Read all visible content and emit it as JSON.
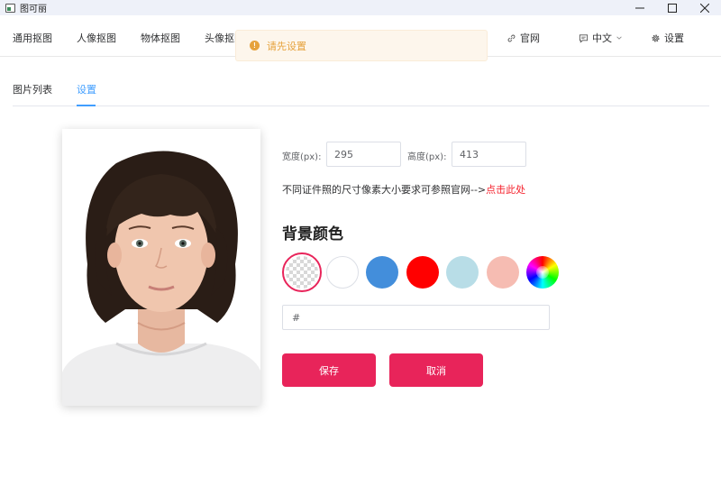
{
  "window": {
    "title": "图可丽",
    "controls": [
      "minimize",
      "maximize",
      "close"
    ]
  },
  "topnav": {
    "items": [
      {
        "label": "通用抠图"
      },
      {
        "label": "人像抠图"
      },
      {
        "label": "物体抠图"
      },
      {
        "label": "头像抠图"
      }
    ],
    "right": {
      "website": {
        "label": "官网",
        "icon": "link-icon"
      },
      "language": {
        "label": "中文",
        "icon": "chat-icon"
      },
      "settings": {
        "label": "设置",
        "icon": "gear-icon"
      }
    }
  },
  "toast": {
    "text": "请先设置",
    "type": "warning",
    "color": "#e6a23c"
  },
  "tabs": [
    {
      "label": "图片列表",
      "active": false
    },
    {
      "label": "设置",
      "active": true
    }
  ],
  "form": {
    "width_label": "宽度(px):",
    "width_value": "295",
    "height_label": "高度(px):",
    "height_value": "413",
    "hint_text": "不同证件照的尺寸像素大小要求可参照官网-->",
    "hint_link": "点击此处",
    "bg_title": "背景颜色",
    "swatches": [
      {
        "name": "transparent",
        "color": "transparent",
        "selected": true
      },
      {
        "name": "white",
        "color": "#ffffff",
        "selected": false
      },
      {
        "name": "blue",
        "color": "#438edb",
        "selected": false
      },
      {
        "name": "red",
        "color": "#ff0000",
        "selected": false
      },
      {
        "name": "light-blue",
        "color": "#b8dde7",
        "selected": false
      },
      {
        "name": "pink",
        "color": "#f6bcb2",
        "selected": false
      },
      {
        "name": "custom",
        "color": "rainbow",
        "selected": false
      }
    ],
    "hex_value": "#"
  },
  "buttons": {
    "save": "保存",
    "cancel": "取消"
  },
  "colors": {
    "accent": "#e8245a",
    "tab_active": "#409eff"
  }
}
